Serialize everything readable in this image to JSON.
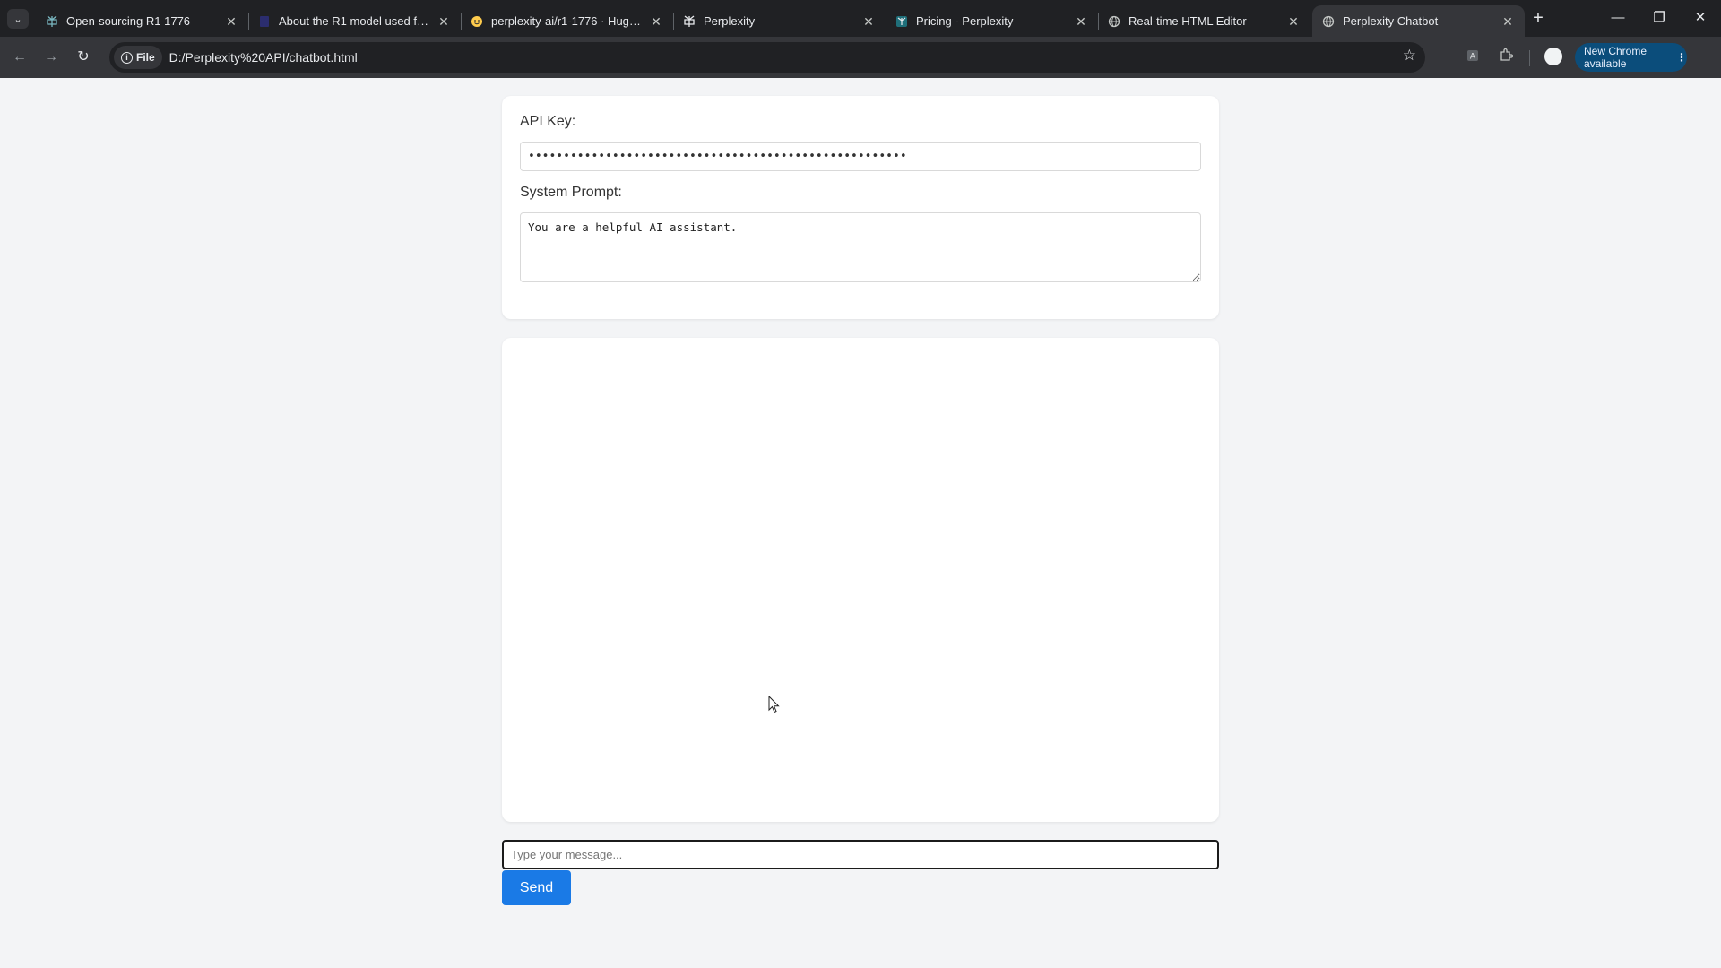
{
  "browser": {
    "tabs": [
      {
        "title": "Open-sourcing R1 1776",
        "favicon": "perplexity-icon"
      },
      {
        "title": "About the R1 model used for Perplexity",
        "favicon": "document-icon"
      },
      {
        "title": "perplexity-ai/r1-1776 · Hugging Face",
        "favicon": "hugging-face-icon"
      },
      {
        "title": "Perplexity",
        "favicon": "perplexity-icon"
      },
      {
        "title": "Pricing - Perplexity",
        "favicon": "perplexity-icon"
      },
      {
        "title": "Real-time HTML Editor",
        "favicon": "globe-icon"
      },
      {
        "title": "Perplexity Chatbot",
        "favicon": "globe-icon",
        "active": true
      }
    ],
    "address_bar": {
      "scheme_chip": "File",
      "url": "D:/Perplexity%20API/chatbot.html"
    },
    "update_button": "New Chrome available"
  },
  "settings": {
    "api_key_label": "API Key:",
    "api_key_value": "••••••••••••••••••••••••••••••••••••••••••••••••••••••",
    "system_prompt_label": "System Prompt:",
    "system_prompt_value": "You are a helpful AI assistant."
  },
  "chat": {
    "messages": [],
    "input_placeholder": "Type your message...",
    "send_label": "Send"
  },
  "colors": {
    "page_background": "#f3f4f6",
    "card_background": "#ffffff",
    "send_button": "#1a7ae6",
    "chrome_dark": "#202124",
    "chrome_toolbar": "#35363a"
  }
}
